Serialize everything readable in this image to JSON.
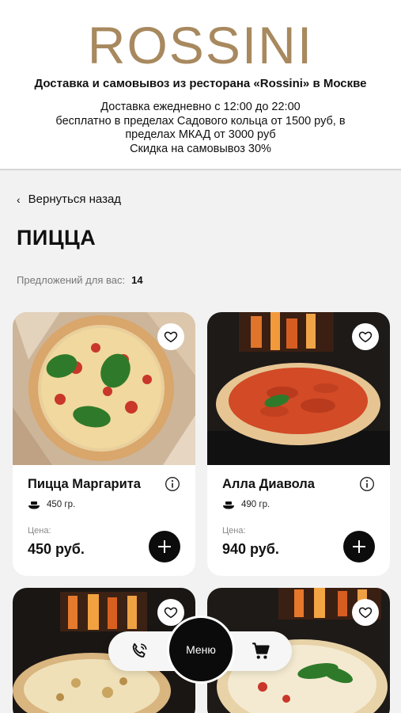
{
  "header": {
    "logo": "ROSSINI",
    "tagline": "Доставка и самовывоз из ресторана «Rossini» в Москве",
    "info_lines": [
      "Доставка ежедневно с 12:00 до 22:00",
      "бесплатно в пределах Садового кольца от 1500 руб, в",
      "пределах МКАД от 3000 руб",
      "Скидка на самовывоз 30%"
    ]
  },
  "nav": {
    "back_label": "Вернуться назад"
  },
  "page": {
    "title": "ПИЦЦА",
    "count_label": "Предложений для вас:",
    "count_value": "14"
  },
  "products": [
    {
      "name": "Пицца Маргарита",
      "weight": "450 гр.",
      "price_label": "Цена:",
      "price": "450 руб."
    },
    {
      "name": "Алла Диавола",
      "weight": "490 гр.",
      "price_label": "Цена:",
      "price": "940 руб."
    }
  ],
  "bottom_nav": {
    "menu_label": "Меню",
    "icons": [
      "phone-icon",
      "cart-icon"
    ]
  },
  "colors": {
    "brand": "#a8895f",
    "background": "#f2f2f2",
    "button": "#0c0c0c"
  }
}
